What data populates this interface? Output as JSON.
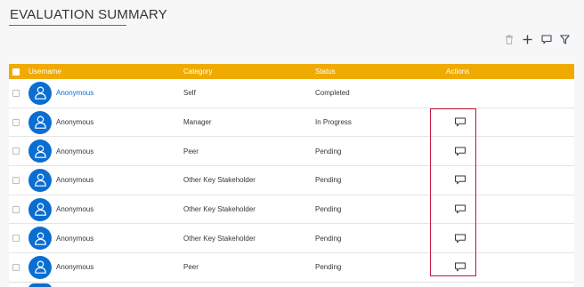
{
  "page": {
    "title": "EVALUATION SUMMARY"
  },
  "colors": {
    "header": "#f0ab00",
    "avatar": "#0a6ed1",
    "highlight": "#c3173a",
    "link": "#0a6ed1"
  },
  "toolbar": {
    "icons": [
      "trash-icon",
      "plus-icon",
      "comment-icon",
      "filter-icon"
    ]
  },
  "table": {
    "headers": {
      "username": "Username",
      "category": "Category",
      "status": "Status",
      "actions": "Actions"
    },
    "rows": [
      {
        "username": "Anonymous",
        "category": "Self",
        "status": "Completed"
      },
      {
        "username": "Anonymous",
        "category": "Manager",
        "status": "In Progress"
      },
      {
        "username": "Anonymous",
        "category": "Peer",
        "status": "Pending"
      },
      {
        "username": "Anonymous",
        "category": "Other Key Stakeholder",
        "status": "Pending"
      },
      {
        "username": "Anonymous",
        "category": "Other Key Stakeholder",
        "status": "Pending"
      },
      {
        "username": "Anonymous",
        "category": "Other Key Stakeholder",
        "status": "Pending"
      },
      {
        "username": "Anonymous",
        "category": "Peer",
        "status": "Pending"
      }
    ]
  }
}
